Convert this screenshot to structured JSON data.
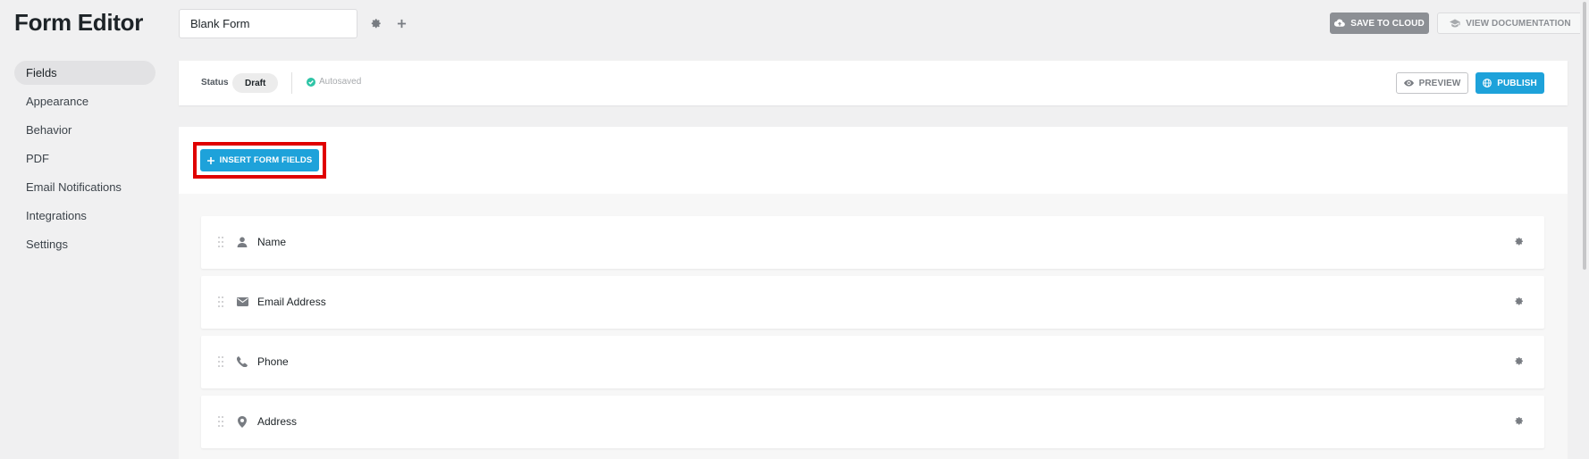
{
  "app": {
    "title": "Form Editor",
    "form_name": "Blank Form"
  },
  "sidebar": {
    "items": [
      {
        "label": "Fields",
        "active": true
      },
      {
        "label": "Appearance",
        "active": false
      },
      {
        "label": "Behavior",
        "active": false
      },
      {
        "label": "PDF",
        "active": false
      },
      {
        "label": "Email Notifications",
        "active": false
      },
      {
        "label": "Integrations",
        "active": false
      },
      {
        "label": "Settings",
        "active": false
      }
    ]
  },
  "toolbar": {
    "settings_icon": "gear-icon",
    "add_icon": "plus-icon",
    "save_cloud_label": "SAVE TO CLOUD",
    "save_cloud_icon": "cloud-upload-icon",
    "docs_label": "VIEW DOCUMENTATION",
    "docs_icon": "graduation-cap-icon"
  },
  "status_bar": {
    "status_label": "Status",
    "status_value": "Draft",
    "autosave_text": "Autosaved",
    "autosave_icon": "check-circle-icon",
    "preview_label": "PREVIEW",
    "preview_icon": "eye-icon",
    "publish_label": "PUBLISH",
    "publish_icon": "globe-icon"
  },
  "fields_panel": {
    "insert_label": "INSERT FORM FIELDS",
    "insert_icon": "plus-icon",
    "fields": [
      {
        "label": "Name",
        "icon": "user-icon"
      },
      {
        "label": "Email Address",
        "icon": "envelope-icon"
      },
      {
        "label": "Phone",
        "icon": "phone-icon"
      },
      {
        "label": "Address",
        "icon": "map-pin-icon"
      }
    ]
  },
  "colors": {
    "accent": "#1ea2da",
    "highlight": "#e00000",
    "background": "#f0f0f1",
    "autosave_check": "#2ec4a6"
  }
}
